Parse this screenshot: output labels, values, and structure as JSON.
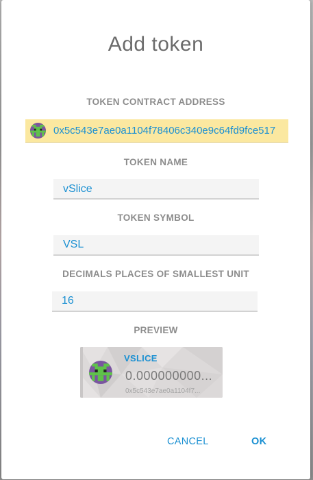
{
  "dialog": {
    "title": "Add token",
    "cancel_label": "CANCEL",
    "ok_label": "OK"
  },
  "form": {
    "contract_address_label": "TOKEN CONTRACT ADDRESS",
    "contract_address_value": "0x5c543e7ae0a1104f78406c340e9c64fd9fce517",
    "token_name_label": "TOKEN NAME",
    "token_name_value": "vSlice",
    "token_symbol_label": "TOKEN SYMBOL",
    "token_symbol_value": "VSL",
    "decimals_label": "DECIMALS PLACES OF SMALLEST UNIT",
    "decimals_value": "16"
  },
  "preview": {
    "label": "PREVIEW",
    "symbol": "VSLICE",
    "balance": "0.000000000...",
    "address": "0x5c543e7ae0a1104f7..."
  },
  "icons": {
    "token_identicon": "identicon"
  },
  "colors": {
    "accent": "#1b90d2",
    "address_highlight": "#fbe8a0",
    "label_gray": "#8c8c8c",
    "title_gray": "#6b6b6b"
  }
}
